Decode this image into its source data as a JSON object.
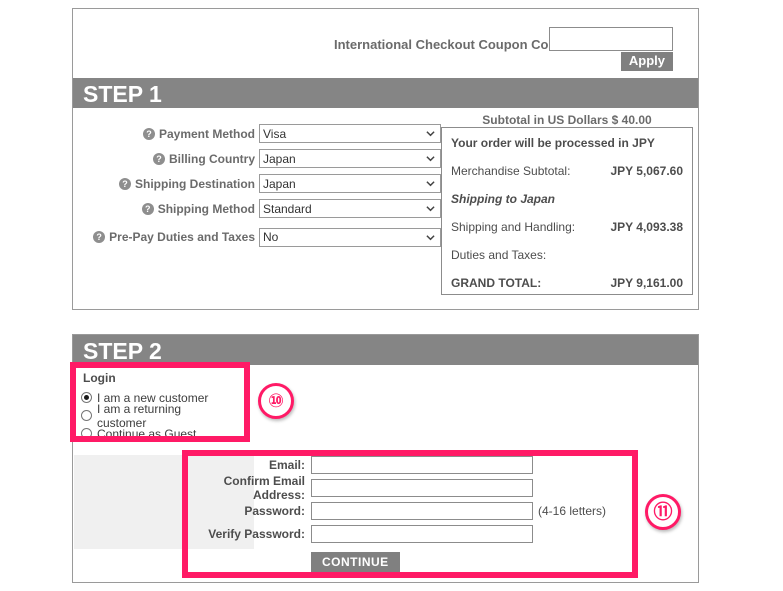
{
  "coupon": {
    "label": "International Checkout Coupon Code:",
    "value": "",
    "placeholder": "",
    "apply_label": "Apply"
  },
  "step1": {
    "title": "STEP 1",
    "subtotal_line": "Subtotal in US Dollars $ 40.00",
    "fields": [
      {
        "label": "Payment Method",
        "value": "Visa",
        "help": "?"
      },
      {
        "label": "Billing Country",
        "value": "Japan",
        "help": "?"
      },
      {
        "label": "Shipping Destination",
        "value": "Japan",
        "help": "?"
      },
      {
        "label": "Shipping Method",
        "value": "Standard",
        "help": "?"
      },
      {
        "label": "Pre-Pay Duties and Taxes",
        "value": "No",
        "help": "?"
      }
    ],
    "summary": {
      "heading": "Your order will be processed in JPY",
      "merchandise_label": "Merchandise Subtotal:",
      "merchandise_value": "JPY 5,067.60",
      "shipping_to": "Shipping to Japan",
      "shipping_label": "Shipping and Handling:",
      "shipping_value": "JPY 4,093.38",
      "duties_label": "Duties and Taxes:",
      "duties_value": "",
      "total_label": "GRAND TOTAL:",
      "total_value": "JPY 9,161.00"
    }
  },
  "step2": {
    "title": "STEP 2",
    "login": {
      "heading": "Login",
      "options": [
        {
          "label": "I am a new customer",
          "selected": true
        },
        {
          "label": "I am a returning customer",
          "selected": false
        },
        {
          "label": "Continue as Guest",
          "selected": false
        }
      ]
    },
    "account": {
      "email_label": "Email:",
      "email_value": "",
      "confirm_email_label": "Confirm Email Address:",
      "confirm_email_value": "",
      "password_label": "Password:",
      "password_value": "",
      "password_hint": "(4-16 letters)",
      "verify_password_label": "Verify Password:",
      "verify_password_value": "",
      "continue_label": "CONTINUE"
    }
  },
  "annotations": [
    {
      "marker": "⑩"
    },
    {
      "marker": "⑪"
    }
  ],
  "colors": {
    "step_bar": "#858585",
    "button_gray": "#808080",
    "annotation_pink": "#ff1a66",
    "label_gray": "#6b6b6b"
  }
}
